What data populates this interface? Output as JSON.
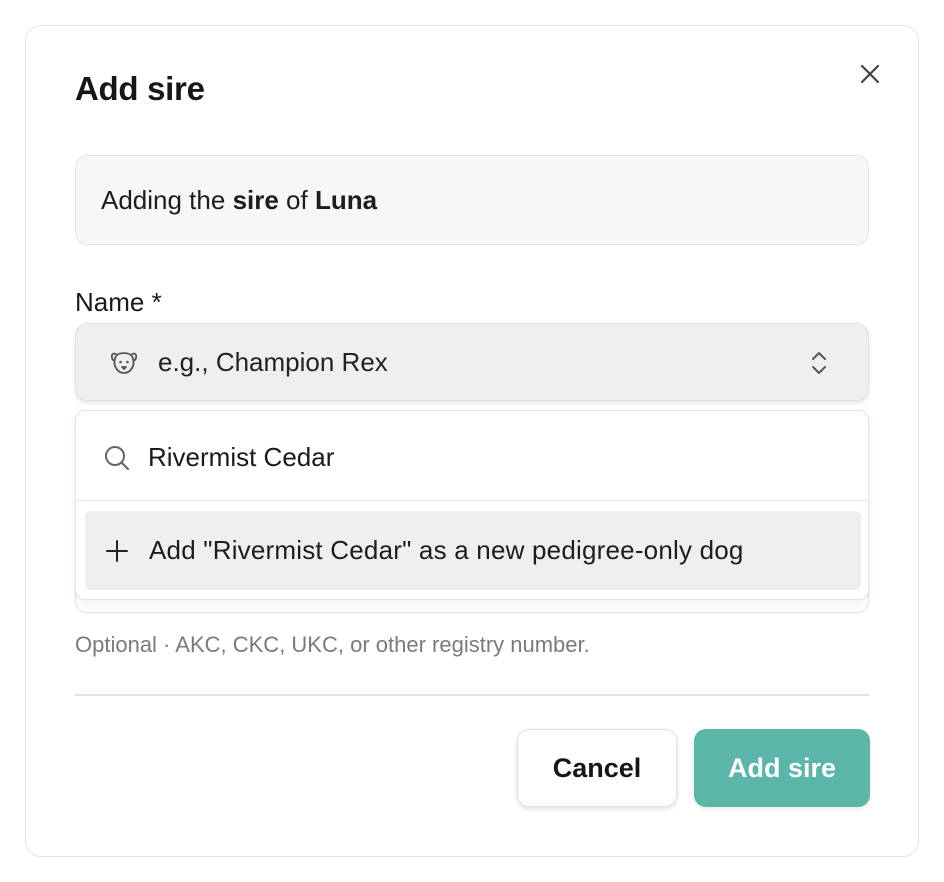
{
  "dialog": {
    "title": "Add sire",
    "close_icon": "close-icon",
    "context": {
      "prefix": "Adding the ",
      "role": "sire",
      "middle": " of ",
      "subject": "Luna"
    }
  },
  "name_field": {
    "label": "Name *",
    "icon": "dog-face-icon",
    "placeholder": "e.g., Champion Rex",
    "trailing_icon": "chevron-up-down-icon"
  },
  "combobox": {
    "search_icon": "search-icon",
    "search_value": "Rivermist Cedar",
    "add_option": {
      "icon": "plus-icon",
      "label": "Add \"Rivermist Cedar\" as a new pedigree-only dog"
    }
  },
  "registration_field": {
    "helper": "Optional · AKC, CKC, UKC, or other registry number."
  },
  "footer": {
    "cancel_label": "Cancel",
    "submit_label": "Add sire"
  },
  "colors": {
    "accent": "#5bb5a8",
    "border": "#e3e3e3",
    "muted_text": "#7a7a7a",
    "option_highlight": "#efefef"
  }
}
